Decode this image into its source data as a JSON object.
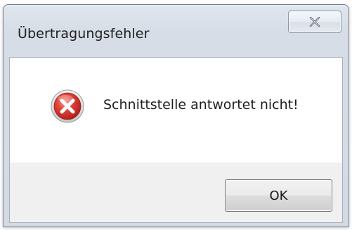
{
  "window": {
    "title": "Übertragungsfehler",
    "close_icon": "close-icon"
  },
  "dialog": {
    "icon": "error-icon",
    "message": "Schnittstelle antwortet nicht!",
    "ok_label": "OK"
  },
  "colors": {
    "error_red": "#d9322e",
    "frame": "#d6dde6",
    "content_bg": "#ffffff",
    "footer_bg": "#f0f0f0"
  }
}
